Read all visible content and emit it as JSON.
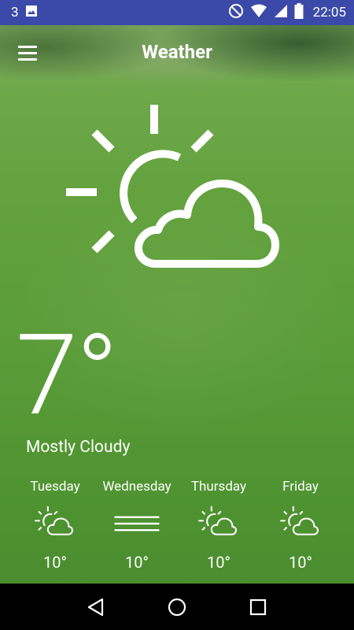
{
  "status_bar": {
    "notification_count": "3",
    "time": "22:05",
    "icons": [
      "image-icon",
      "do-not-disturb-icon",
      "wifi-icon",
      "cell-signal-icon",
      "battery-icon"
    ]
  },
  "app_bar": {
    "title": "Weather",
    "menu_icon": "hamburger-menu-icon"
  },
  "current": {
    "icon": "partly-cloudy-icon",
    "temperature": "7°",
    "condition": "Mostly Cloudy"
  },
  "forecast": [
    {
      "day": "Tuesday",
      "icon": "partly-cloudy-icon",
      "temp": "10°"
    },
    {
      "day": "Wednesday",
      "icon": "fog-icon",
      "temp": "10°"
    },
    {
      "day": "Thursday",
      "icon": "partly-cloudy-icon",
      "temp": "10°"
    },
    {
      "day": "Friday",
      "icon": "partly-cloudy-icon",
      "temp": "10°"
    }
  ],
  "nav_bar": {
    "icons": [
      "back-icon",
      "home-icon",
      "recents-icon"
    ]
  },
  "colors": {
    "status_bar": "#3b4aa8",
    "nav_bar": "#000000",
    "foreground": "#ffffff",
    "background": "#5b9a3c"
  }
}
